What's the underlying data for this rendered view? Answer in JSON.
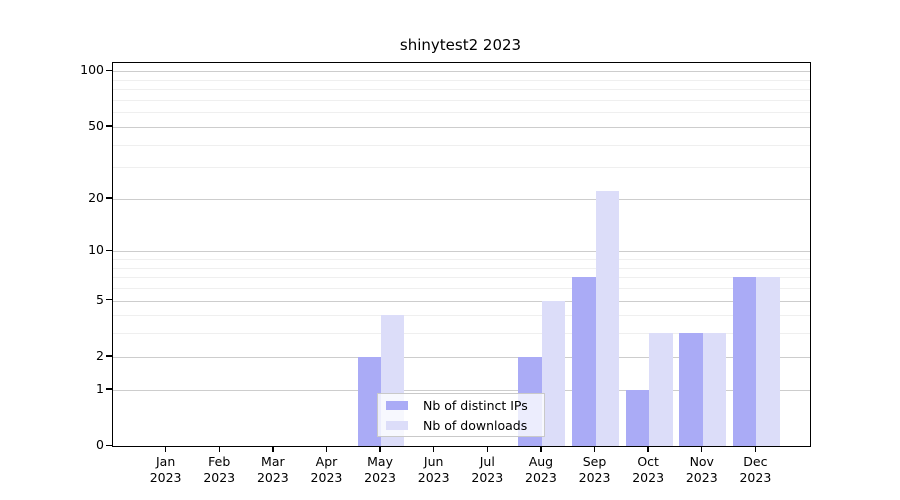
{
  "chart_data": {
    "type": "bar",
    "title": "shinytest2 2023",
    "categories": [
      "Jan",
      "Feb",
      "Mar",
      "Apr",
      "May",
      "Jun",
      "Jul",
      "Aug",
      "Sep",
      "Oct",
      "Nov",
      "Dec"
    ],
    "year_label": "2023",
    "series": [
      {
        "name": "Nb of distinct IPs",
        "color": "#aaabf6",
        "values": [
          0,
          0,
          0,
          0,
          2,
          0,
          0,
          2,
          7,
          1,
          3,
          7
        ]
      },
      {
        "name": "Nb of downloads",
        "color": "#dcddf9",
        "values": [
          0,
          0,
          0,
          0,
          4,
          0,
          0,
          5,
          22,
          3,
          3,
          7
        ]
      }
    ],
    "y_axis": {
      "scale": "log1p",
      "tick_labels": [
        0,
        1,
        2,
        5,
        10,
        20,
        50,
        100
      ],
      "minor_gridlines": [
        3,
        4,
        6,
        7,
        8,
        9,
        30,
        40,
        60,
        70,
        80,
        90
      ],
      "ylim": [
        0,
        111
      ]
    },
    "x_axis": {
      "label_line2": "2023"
    },
    "legend": {
      "position": "bottom-center"
    },
    "grid": true,
    "colors": {
      "background": "#ffffff",
      "axis": "#000000",
      "major_grid": "#cdcdcd",
      "minor_grid": "#efefef"
    }
  }
}
